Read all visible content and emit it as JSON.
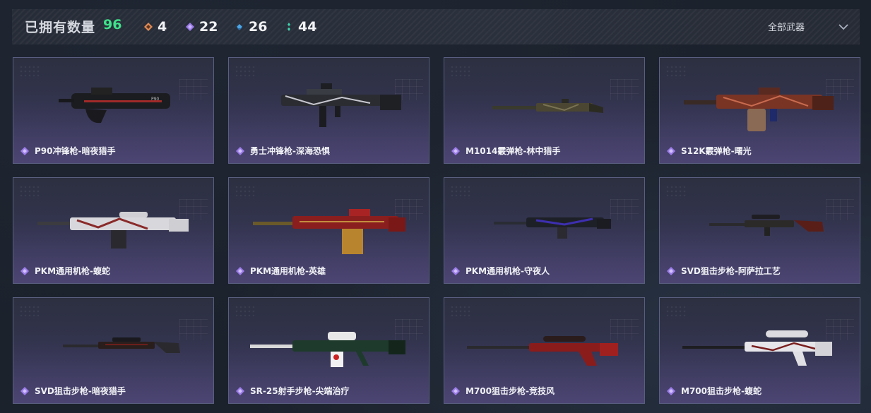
{
  "header": {
    "title": "已拥有数量",
    "total": "96",
    "stats": [
      {
        "icon": "orange-diamond-icon",
        "color": "#e08a55",
        "value": "4"
      },
      {
        "icon": "purple-diamond-icon",
        "color": "#9b7be8",
        "value": "22"
      },
      {
        "icon": "blue-diamond-icon",
        "color": "#4aa6e8",
        "value": "26"
      },
      {
        "icon": "green-diamond-icon",
        "color": "#3fd6b0",
        "value": "44"
      }
    ],
    "filter": {
      "label": "全部武器",
      "icon": "chevron-down-icon"
    }
  },
  "colors": {
    "total": "#3fe28a",
    "card_border": "#5a5e80",
    "rarity_purple": "#9b7be8"
  },
  "weapons": [
    {
      "name": "P90冲锋枪-暗夜猎手",
      "icon": "purple-diamond-icon"
    },
    {
      "name": "勇士冲锋枪-深海恐惧",
      "icon": "purple-diamond-icon"
    },
    {
      "name": "M1014霰弹枪-林中猎手",
      "icon": "purple-diamond-icon"
    },
    {
      "name": "S12K霰弹枪-曙光",
      "icon": "purple-diamond-icon"
    },
    {
      "name": "PKM通用机枪-蝮蛇",
      "icon": "purple-diamond-icon"
    },
    {
      "name": "PKM通用机枪-英雄",
      "icon": "purple-diamond-icon"
    },
    {
      "name": "PKM通用机枪-守夜人",
      "icon": "purple-diamond-icon"
    },
    {
      "name": "SVD狙击步枪-阿萨拉工艺",
      "icon": "purple-diamond-icon"
    },
    {
      "name": "SVD狙击步枪-暗夜猎手",
      "icon": "purple-diamond-icon"
    },
    {
      "name": "SR-25射手步枪-尖端治疗",
      "icon": "purple-diamond-icon"
    },
    {
      "name": "M700狙击步枪-竞技风",
      "icon": "purple-diamond-icon"
    },
    {
      "name": "M700狙击步枪-蝮蛇",
      "icon": "purple-diamond-icon"
    }
  ]
}
